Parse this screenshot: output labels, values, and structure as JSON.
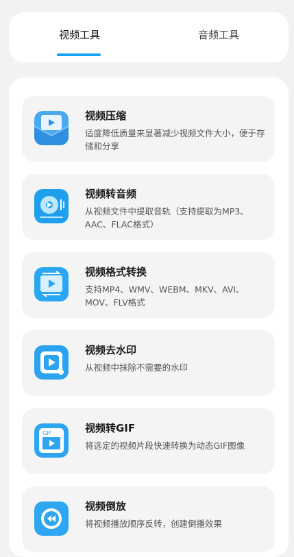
{
  "tabs": [
    {
      "label": "视频工具",
      "active": true
    },
    {
      "label": "音频工具",
      "active": false
    }
  ],
  "accent_color": "#1aa3f5",
  "items": [
    {
      "title": "视频压缩",
      "desc": "适度降低质量来显著减少视频文件大小，便于存储和分享",
      "icon": "video-compress-icon"
    },
    {
      "title": "视频转音频",
      "desc": "从视频文件中提取音轨（支持提取为MP3、AAC、FLAC格式）",
      "icon": "video-to-audio-icon"
    },
    {
      "title": "视频格式转换",
      "desc": "支持MP4、WMV、WEBM、MKV、AVI、MOV、FLV格式",
      "icon": "format-convert-icon"
    },
    {
      "title": "视频去水印",
      "desc": "从视频中抹除不需要的水印",
      "icon": "watermark-remove-icon"
    },
    {
      "title": "视频转GIF",
      "desc": "将选定的视频片段快速转换为动态GIF图像",
      "icon": "video-to-gif-icon",
      "icon_text": "GIF"
    },
    {
      "title": "视频倒放",
      "desc": "将视频播放顺序反转，创建倒播效果",
      "icon": "video-reverse-icon"
    }
  ]
}
